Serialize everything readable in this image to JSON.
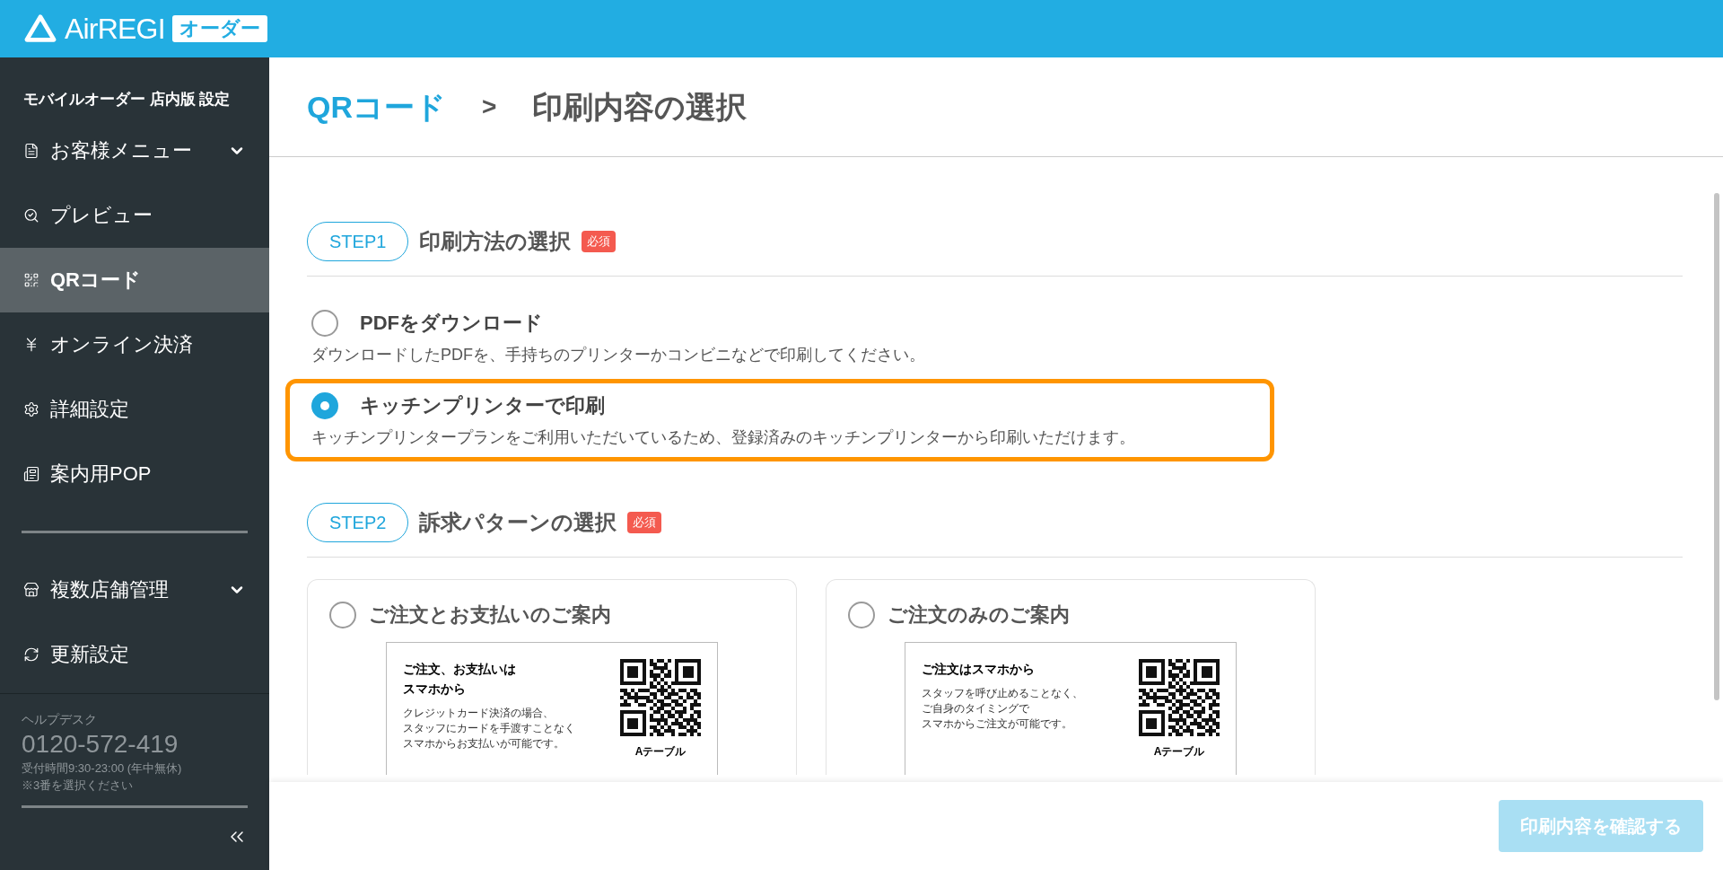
{
  "header": {
    "logo": "AirREGI",
    "logo_badge": "オーダー"
  },
  "sidebar": {
    "title": "モバイルオーダー 店内版 設定",
    "items": [
      {
        "label": "お客様メニュー",
        "selected": false,
        "expandable": true
      },
      {
        "label": "プレビュー",
        "selected": false,
        "expandable": false
      },
      {
        "label": "QRコード",
        "selected": true,
        "expandable": false
      },
      {
        "label": "オンライン決済",
        "selected": false,
        "expandable": false
      },
      {
        "label": "詳細設定",
        "selected": false,
        "expandable": false
      },
      {
        "label": "案内用POP",
        "selected": false,
        "expandable": false
      }
    ],
    "items2": [
      {
        "label": "複数店舗管理",
        "selected": false,
        "expandable": true
      },
      {
        "label": "更新設定",
        "selected": false,
        "expandable": false
      }
    ],
    "helpdesk": {
      "label": "ヘルプデスク",
      "phone": "0120-572-419",
      "hours": "受付時間9:30-23:00 (年中無休)",
      "note": "※3番を選択ください"
    }
  },
  "breadcrumb": {
    "parent": "QRコード",
    "separator": ">",
    "current": "印刷内容の選択"
  },
  "step1": {
    "badge": "STEP1",
    "title": "印刷方法の選択",
    "required": "必須",
    "options": [
      {
        "label": "PDFをダウンロード",
        "description": "ダウンロードしたPDFを、手持ちのプリンターかコンビニなどで印刷してください。",
        "selected": false,
        "highlighted": false
      },
      {
        "label": "キッチンプリンターで印刷",
        "description": "キッチンプリンタープランをご利用いただいているため、登録済みのキッチンプリンターから印刷いただけます。",
        "selected": true,
        "highlighted": true
      }
    ]
  },
  "step2": {
    "badge": "STEP2",
    "title": "訴求パターンの選択",
    "required": "必須",
    "cards": [
      {
        "label": "ご注文とお支払いのご案内",
        "selected": false,
        "preview": {
          "heading": [
            "ご注文、お支払いは",
            "スマホから"
          ],
          "body": [
            "クレジットカード決済の場合、",
            "スタッフにカードを手渡すことなく",
            "スマホからお支払いが可能です。"
          ],
          "table": "Aテーブル"
        }
      },
      {
        "label": "ご注文のみのご案内",
        "selected": false,
        "preview": {
          "heading": [
            "ご注文はスマホから"
          ],
          "body": [
            "スタッフを呼び止めることなく、",
            "ご自身のタイミングで",
            "スマホからご注文が可能です。"
          ],
          "table": "Aテーブル"
        }
      }
    ]
  },
  "footer": {
    "button": "印刷内容を確認する",
    "disabled": true
  }
}
